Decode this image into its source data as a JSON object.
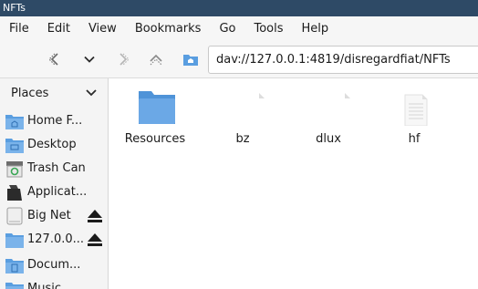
{
  "window": {
    "title": "NFTs"
  },
  "menu": [
    "File",
    "Edit",
    "View",
    "Bookmarks",
    "Go",
    "Tools",
    "Help"
  ],
  "toolbar": {
    "location": "dav://127.0.0.1:4819/disregardfiat/NFTs"
  },
  "sidebar": {
    "section_label": "Places",
    "items": [
      {
        "label": "Home F...",
        "icon": "home-folder-icon"
      },
      {
        "label": "Desktop",
        "icon": "desktop-folder-icon"
      },
      {
        "label": "Trash Can",
        "icon": "trash-icon"
      },
      {
        "label": "Applicat...",
        "icon": "applications-icon"
      },
      {
        "label": "Big Net",
        "icon": "drive-icon",
        "ejectable": true
      },
      {
        "label": "127.0.0...",
        "icon": "network-folder-icon",
        "ejectable": true
      },
      {
        "label": "Docum...",
        "icon": "documents-folder-icon"
      },
      {
        "label": "Music",
        "icon": "music-folder-icon"
      }
    ]
  },
  "files": [
    {
      "name": "Resources",
      "type": "folder"
    },
    {
      "name": "bz",
      "type": "file"
    },
    {
      "name": "dlux",
      "type": "file"
    },
    {
      "name": "hf",
      "type": "text-file"
    }
  ],
  "colors": {
    "titlebar": "#2e4a66",
    "folder": "#5a9ee0",
    "accent": "#3d8be0"
  }
}
